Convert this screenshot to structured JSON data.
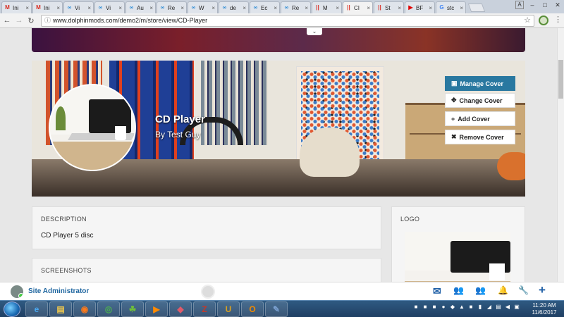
{
  "browser": {
    "tabs": [
      {
        "label": "Ini",
        "icon": "gmail-icon",
        "color": "#d93025",
        "glyph": "M",
        "active": false
      },
      {
        "label": "Ini",
        "icon": "gmail-icon",
        "color": "#d93025",
        "glyph": "M",
        "active": false
      },
      {
        "label": "Vi",
        "icon": "dolphin-icon",
        "color": "#2a8ad4",
        "glyph": "∞",
        "active": false
      },
      {
        "label": "Vi",
        "icon": "dolphin-icon",
        "color": "#2a8ad4",
        "glyph": "∞",
        "active": false
      },
      {
        "label": "Au",
        "icon": "dolphin-icon",
        "color": "#2a8ad4",
        "glyph": "∞",
        "active": false
      },
      {
        "label": "Re",
        "icon": "dolphin-icon",
        "color": "#2a8ad4",
        "glyph": "∞",
        "active": false
      },
      {
        "label": "W",
        "icon": "dolphin-icon",
        "color": "#2a8ad4",
        "glyph": "∞",
        "active": false
      },
      {
        "label": "de",
        "icon": "dolphin-icon",
        "color": "#2a8ad4",
        "glyph": "∞",
        "active": false
      },
      {
        "label": "Ec",
        "icon": "dolphin-icon",
        "color": "#2a8ad4",
        "glyph": "∞",
        "active": false
      },
      {
        "label": "Re",
        "icon": "dolphin-icon",
        "color": "#2a8ad4",
        "glyph": "∞",
        "active": false
      },
      {
        "label": "M",
        "icon": "bars-icon",
        "color": "#d93025",
        "glyph": "||",
        "active": false
      },
      {
        "label": "CI",
        "icon": "bars-icon",
        "color": "#d93025",
        "glyph": "||",
        "active": true
      },
      {
        "label": "St",
        "icon": "bars-icon",
        "color": "#d93025",
        "glyph": "||",
        "active": false
      },
      {
        "label": "BF",
        "icon": "youtube-icon",
        "color": "#e00000",
        "glyph": "▶",
        "active": false
      },
      {
        "label": "stc",
        "icon": "google-icon",
        "color": "#4285f4",
        "glyph": "G",
        "active": false
      }
    ],
    "window_controls": [
      "A",
      "–",
      "□",
      "✕"
    ],
    "url": "www.dolphinmods.com/demo2/m/store/view/CD-Player"
  },
  "cover": {
    "title": "CD Player",
    "byline": "By Test Guy",
    "buttons": [
      {
        "label": "Manage Cover",
        "icon": "image-icon",
        "glyph": "▣",
        "primary": true
      },
      {
        "label": "Change Cover",
        "icon": "move-icon",
        "glyph": "✥",
        "primary": false
      },
      {
        "label": "Add Cover",
        "icon": "plus-icon",
        "glyph": "+",
        "primary": false
      },
      {
        "label": "Remove Cover",
        "icon": "times-icon",
        "glyph": "✖",
        "primary": false
      }
    ]
  },
  "description": {
    "heading": "DESCRIPTION",
    "value": "CD Player 5 disc"
  },
  "screenshots": {
    "heading": "SCREENSHOTS"
  },
  "logo": {
    "heading": "LOGO"
  },
  "chat": {
    "name": "Site Administrator",
    "icons": [
      {
        "name": "envelope-icon",
        "glyph": "✉"
      },
      {
        "name": "users-icon",
        "glyph": "👥"
      },
      {
        "name": "group-icon",
        "glyph": "👥"
      },
      {
        "name": "bell-icon",
        "glyph": "🔔"
      },
      {
        "name": "wrench-icon",
        "glyph": "🔧"
      },
      {
        "name": "plus-icon",
        "glyph": "+"
      }
    ]
  },
  "taskbar": {
    "apps": [
      {
        "name": "ie-icon",
        "glyph": "e",
        "color": "#4aa8f0"
      },
      {
        "name": "explorer-icon",
        "glyph": "▤",
        "color": "#f2c94c"
      },
      {
        "name": "firefox-icon",
        "glyph": "◉",
        "color": "#ff7a1a"
      },
      {
        "name": "chrome-icon",
        "glyph": "◎",
        "color": "#4caf50"
      },
      {
        "name": "frog-icon",
        "glyph": "☘",
        "color": "#6fbf3a"
      },
      {
        "name": "media-icon",
        "glyph": "▶",
        "color": "#ff8a00"
      },
      {
        "name": "eraser-icon",
        "glyph": "◆",
        "color": "#e05a6a"
      },
      {
        "name": "filezilla-icon",
        "glyph": "Z",
        "color": "#c0392b"
      },
      {
        "name": "ue-icon",
        "glyph": "U",
        "color": "#d8a020"
      },
      {
        "name": "outlook-icon",
        "glyph": "O",
        "color": "#f08a00"
      },
      {
        "name": "paint-icon",
        "glyph": "✎",
        "color": "#7aa0d0"
      }
    ],
    "time": "11:20 AM",
    "date": "11/6/2017"
  }
}
